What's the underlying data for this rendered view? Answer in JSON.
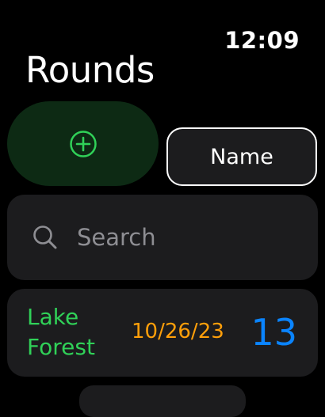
{
  "status_bar": {
    "time": "12:09"
  },
  "header": {
    "title": "Rounds"
  },
  "toolbar": {
    "add_icon": "plus-circle-icon",
    "sort_label": "Name"
  },
  "search": {
    "icon": "magnifying-glass-icon",
    "placeholder": "Search"
  },
  "rounds": [
    {
      "course": "Lake Forest",
      "date": "10/26/23",
      "score": "13"
    }
  ],
  "colors": {
    "background": "#000000",
    "card": "#1c1c1e",
    "add_button_bg": "#0d2a14",
    "accent_green": "#30d158",
    "date_orange": "#ff9f0a",
    "score_blue": "#0a84ff",
    "placeholder_gray": "#8e8e93"
  }
}
